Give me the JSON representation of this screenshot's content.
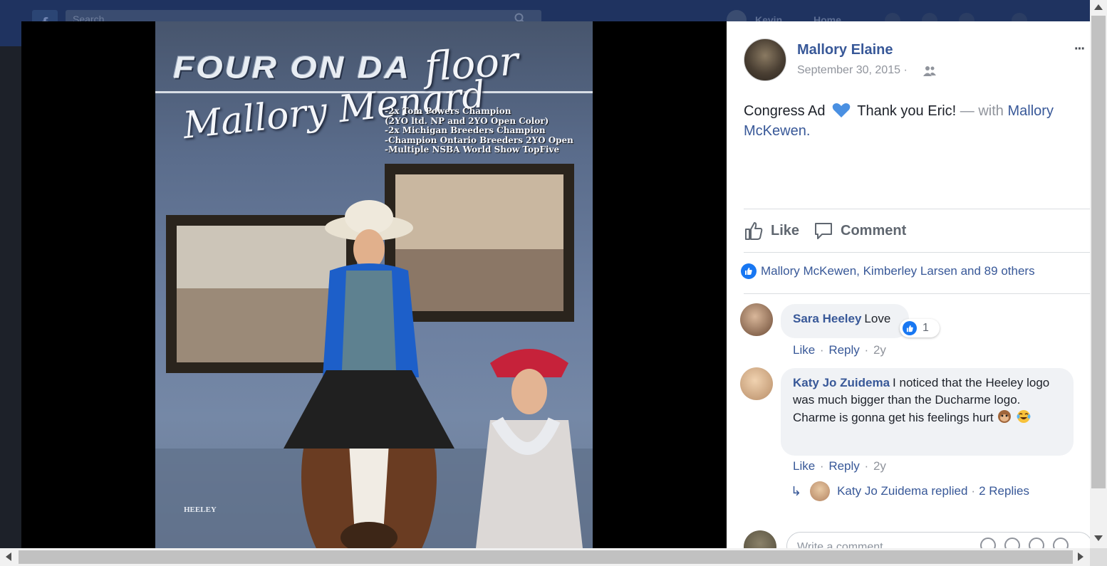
{
  "topbar": {
    "search_placeholder": "Search",
    "user_name": "Kevin",
    "home_label": "Home",
    "logo_glyph": "f"
  },
  "photo": {
    "headline": "FOUR ON DA",
    "headline_script": "floor",
    "rider_name": "Mallory Menard",
    "achievements": [
      "-2x Tom Powers Champion",
      "(2YO ltd. NP and 2YO Open Color)",
      "-2x Michigan Breeders Champion",
      "-Champion Ontario Breeders 2YO Open",
      "-Multiple NSBA World Show TopFive"
    ],
    "brand": "HEELEY"
  },
  "post": {
    "author": "Mallory Elaine",
    "date": "September 30, 2015",
    "date_separator": "·",
    "audience_icon": "friends-icon",
    "more_label": "···",
    "text_before": "Congress Ad",
    "text_after": "Thank you Eric!",
    "with_label": "— with",
    "tagged": "Mallory McKewen."
  },
  "actions": {
    "like": "Like",
    "comment": "Comment"
  },
  "reactions": {
    "summary": "Mallory McKewen, Kimberley Larsen and 89 others"
  },
  "comments": [
    {
      "author": "Sara Heeley",
      "text": "Love",
      "reaction_count": "1",
      "like": "Like",
      "reply": "Reply",
      "sep": "·",
      "time": "2y"
    },
    {
      "author": "Katy Jo Zuidema",
      "text": "I noticed that the Heeley logo was much bigger than the Ducharme logo. Charme is gonna get his feelings hurt",
      "like": "Like",
      "reply": "Reply",
      "sep": "·",
      "time": "2y",
      "replied_text": "Katy Jo Zuidema replied",
      "replies_label": "2 Replies",
      "replied_sep": "·"
    }
  ],
  "composer": {
    "placeholder": "Write a comment..."
  },
  "colors": {
    "link": "#385898",
    "muted": "#90949c",
    "like_blue": "#1877f2"
  }
}
